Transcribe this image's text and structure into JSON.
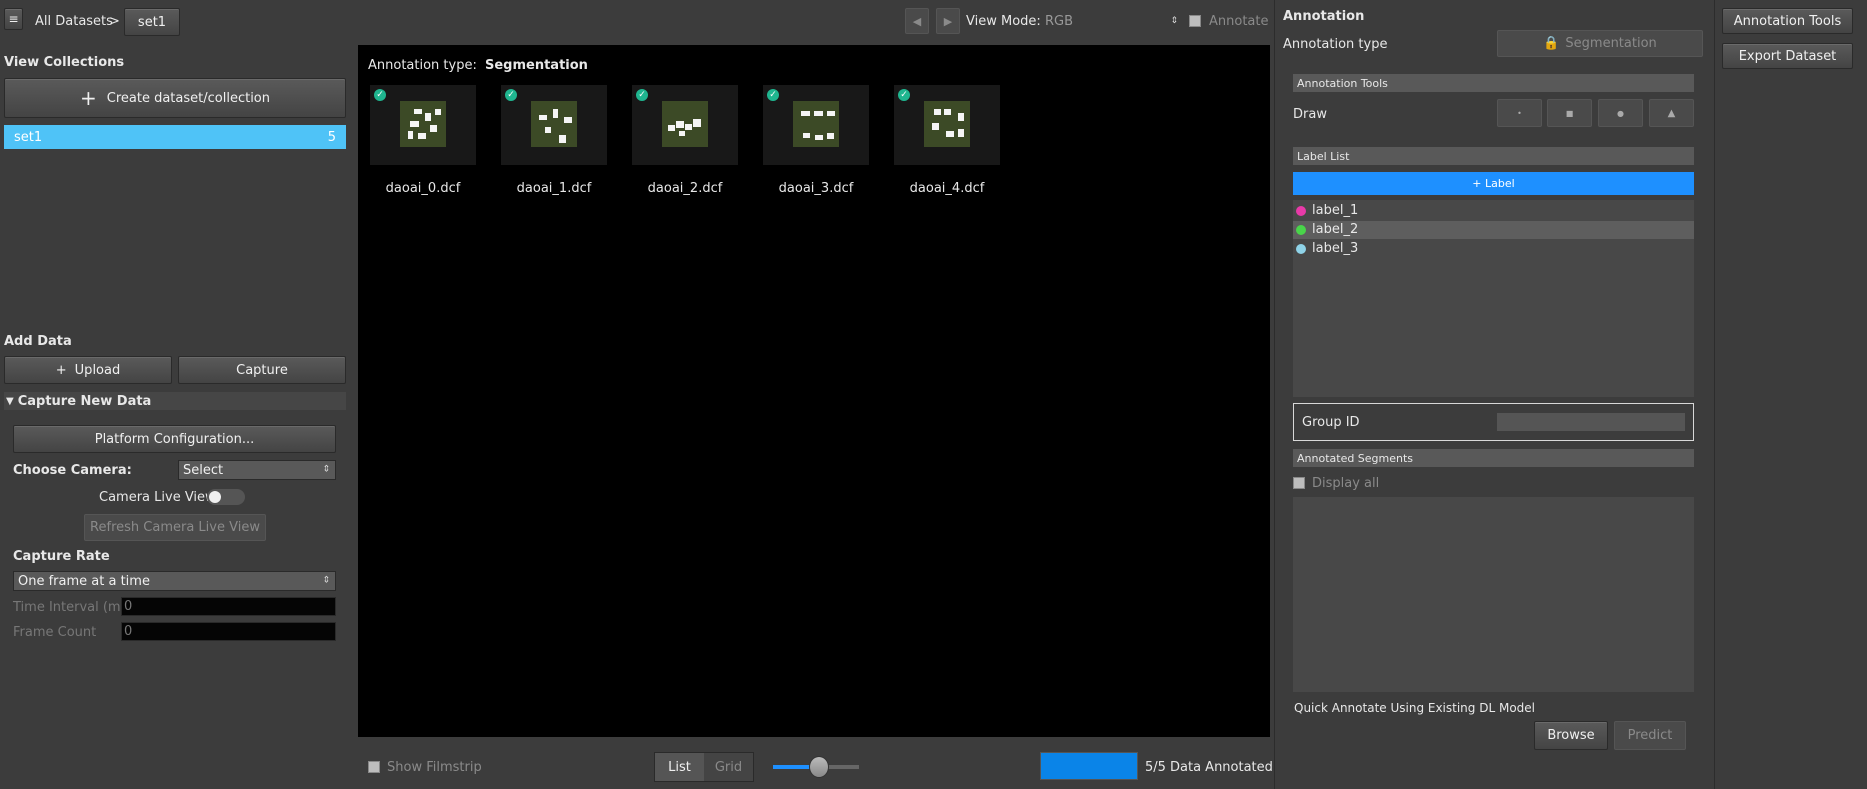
{
  "topbar": {
    "menu_icon": "≡",
    "all_datasets": "All Datasets",
    "separator": ">",
    "current_set": "set1",
    "view_mode_label": "View Mode:",
    "view_mode_value": "RGB",
    "annotate_label": "Annotate"
  },
  "left": {
    "view_collections_title": "View Collections",
    "create_button": "Create dataset/collection",
    "collections": [
      {
        "name": "set1",
        "count": "5"
      }
    ],
    "add_data_title": "Add Data",
    "upload_button": "Upload",
    "capture_button": "Capture",
    "capture_new_data": "Capture New Data",
    "platform_config_button": "Platform Configuration...",
    "choose_camera_label": "Choose Camera:",
    "camera_select": "Select",
    "camera_live_view_label": "Camera Live View",
    "refresh_live_view_button": "Refresh Camera Live View",
    "capture_rate_title": "Capture Rate",
    "capture_rate_select": "One frame at a time",
    "time_interval_label": "Time Interval (ms)",
    "time_interval_value": "0",
    "frame_count_label": "Frame Count",
    "frame_count_value": "0"
  },
  "center": {
    "annotation_type_label": "Annotation type:",
    "annotation_type_value": "Segmentation",
    "images": [
      {
        "name": "daoai_0.dcf"
      },
      {
        "name": "daoai_1.dcf"
      },
      {
        "name": "daoai_2.dcf"
      },
      {
        "name": "daoai_3.dcf"
      },
      {
        "name": "daoai_4.dcf"
      }
    ],
    "show_filmstrip_label": "Show Filmstrip",
    "list_tab": "List",
    "grid_tab": "Grid",
    "annotated_count": "5/5",
    "annotated_label": "Data Annotated",
    "annotated_progress": 1.0
  },
  "right": {
    "title": "Annotation",
    "annotation_type_label": "Annotation type",
    "annotation_type_button": "Segmentation",
    "tools_bar": "Annotation Tools",
    "draw_label": "Draw",
    "label_list_bar": "Label List",
    "add_label_button": "+ Label",
    "labels": [
      {
        "name": "label_1",
        "color": "#e83aa8"
      },
      {
        "name": "label_2",
        "color": "#49d44a"
      },
      {
        "name": "label_3",
        "color": "#8fd3e8"
      }
    ],
    "group_id_label": "Group ID",
    "annotated_segments_bar": "Annotated Segments",
    "display_all_label": "Display all",
    "quick_annotate_label": "Quick Annotate Using Existing DL Model",
    "browse_button": "Browse",
    "predict_button": "Predict"
  },
  "far_right": {
    "annotation_tools_button": "Annotation Tools",
    "export_dataset_button": "Export Dataset"
  },
  "colors": {
    "accent": "#1e90ff",
    "selected_collection": "#4fc3f7"
  }
}
